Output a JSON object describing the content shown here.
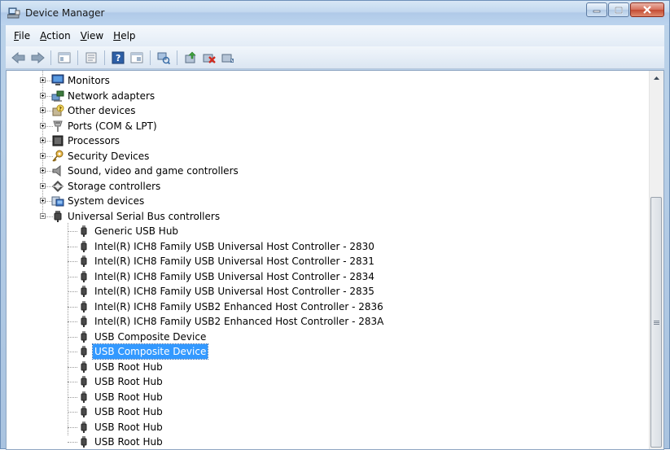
{
  "window": {
    "title": "Device Manager"
  },
  "menu": [
    {
      "label": "File",
      "accel": "F",
      "rest": "ile"
    },
    {
      "label": "Action",
      "accel": "A",
      "rest": "ction"
    },
    {
      "label": "View",
      "accel": "V",
      "rest": "iew"
    },
    {
      "label": "Help",
      "accel": "H",
      "rest": "elp"
    }
  ],
  "toolbar_icons": [
    "back-icon",
    "forward-icon",
    "properties-icon",
    "show-hide-tree-icon",
    "help-icon",
    "action-properties-icon",
    "scan-hardware-icon",
    "update-driver-icon",
    "uninstall-icon",
    "disable-device-icon"
  ],
  "tree": {
    "categories": [
      {
        "label": "Monitors",
        "icon": "monitor-icon",
        "expanded": false
      },
      {
        "label": "Network adapters",
        "icon": "network-adapter-icon",
        "expanded": false
      },
      {
        "label": "Other devices",
        "icon": "unknown-device-icon",
        "expanded": false
      },
      {
        "label": "Ports (COM & LPT)",
        "icon": "port-icon",
        "expanded": false
      },
      {
        "label": "Processors",
        "icon": "processor-icon",
        "expanded": false
      },
      {
        "label": "Security Devices",
        "icon": "security-key-icon",
        "expanded": false
      },
      {
        "label": "Sound, video and game controllers",
        "icon": "speaker-icon",
        "expanded": false
      },
      {
        "label": "Storage controllers",
        "icon": "storage-icon",
        "expanded": false
      },
      {
        "label": "System devices",
        "icon": "system-device-icon",
        "expanded": false
      },
      {
        "label": "Universal Serial Bus controllers",
        "icon": "usb-plug-icon",
        "expanded": true
      }
    ],
    "usb_children": [
      "Generic USB Hub",
      "Intel(R) ICH8 Family USB Universal Host Controller - 2830",
      "Intel(R) ICH8 Family USB Universal Host Controller - 2831",
      "Intel(R) ICH8 Family USB Universal Host Controller - 2834",
      "Intel(R) ICH8 Family USB Universal Host Controller - 2835",
      "Intel(R) ICH8 Family USB2 Enhanced Host Controller - 2836",
      "Intel(R) ICH8 Family USB2 Enhanced Host Controller - 283A",
      "USB Composite Device",
      "USB Composite Device",
      "USB Root Hub",
      "USB Root Hub",
      "USB Root Hub",
      "USB Root Hub",
      "USB Root Hub",
      "USB Root Hub"
    ],
    "selected_child_index": 8
  },
  "colors": {
    "selection": "#3399ff",
    "title_bar": "#c2d8ef",
    "close_button": "#c24a32"
  }
}
